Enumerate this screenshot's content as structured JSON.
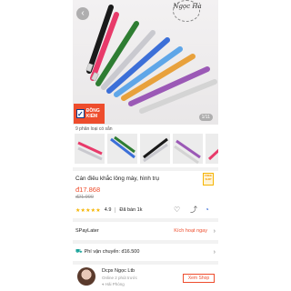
{
  "hero": {
    "logo_text": "Ngọc Hà",
    "sale_badge": "ĐỒNG KIỂM",
    "pager": "1/11",
    "back_icon": "back-arrow-icon"
  },
  "variants": {
    "label": "9 phân loại có sẵn",
    "count_shown": 5
  },
  "product": {
    "title": "Cán điêu khắc lông mày, hình trụ",
    "price": "đ17.868",
    "old_price": "đ21.900",
    "stars": "★★★★★",
    "rating": "4.9",
    "sold": "Đã bán 1k",
    "ship_badge": "FREE SHIP"
  },
  "rows": {
    "spaylater_label": "SPayLater",
    "spaylater_action": "Kích hoạt ngay",
    "shipping_label": "Phí vận chuyển: đ16.500"
  },
  "shop": {
    "name": "Dcpx Ngọc Ltb",
    "status": "Online 2 phút trước",
    "location": "Hải Phòng",
    "view_label": "Xem Shop"
  },
  "colors": {
    "accent": "#ee4d2d",
    "star": "#f5b400",
    "pen_colors": [
      "#1a1a1a",
      "#e83a6a",
      "#2e7d32",
      "#c9c9cf",
      "#3c6fd8",
      "#5fa6e8",
      "#e8a13c",
      "#9b59b6",
      "#d4d4d4"
    ]
  }
}
